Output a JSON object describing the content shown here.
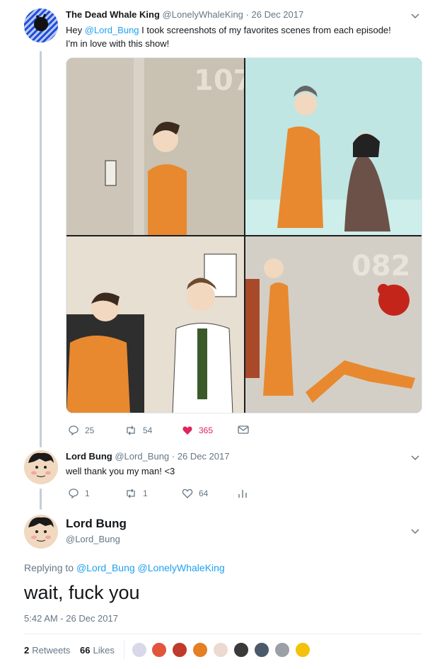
{
  "tweet1": {
    "display_name": "The Dead Whale King",
    "handle": "@LonelyWhaleKing",
    "date": "26 Dec 2017",
    "text_prefix": "Hey ",
    "mention": "@Lord_Bung",
    "text_suffix": " I took screenshots of my favorites scenes from each episode!",
    "text_line2": "I'm in love with this show!",
    "media_labels": {
      "panel1_number": "107",
      "panel4_number": "082"
    },
    "replies": "25",
    "retweets": "54",
    "likes": "365"
  },
  "tweet2": {
    "display_name": "Lord Bung",
    "handle": "@Lord_Bung",
    "date": "26 Dec 2017",
    "text": "well thank you my man! <3",
    "replies": "1",
    "retweets": "1",
    "likes": "64"
  },
  "main_tweet": {
    "display_name": "Lord Bung",
    "handle": "@Lord_Bung",
    "replying_prefix": "Replying to",
    "replying_to": [
      "@Lord_Bung",
      "@LonelyWhaleKing"
    ],
    "text": "wait, fuck you",
    "timestamp": "5:42 AM - 26 Dec 2017",
    "retweets_count": "2",
    "retweets_label": "Retweets",
    "likes_count": "66",
    "likes_label": "Likes"
  },
  "sep": "·",
  "colors": {
    "accent": "#1da1f2",
    "like": "#e0245e",
    "muted": "#657786",
    "orange": "#e8892f"
  },
  "icons": [
    "chevron-down-icon",
    "reply-icon",
    "retweet-icon",
    "heart-icon",
    "envelope-icon",
    "analytics-icon"
  ]
}
